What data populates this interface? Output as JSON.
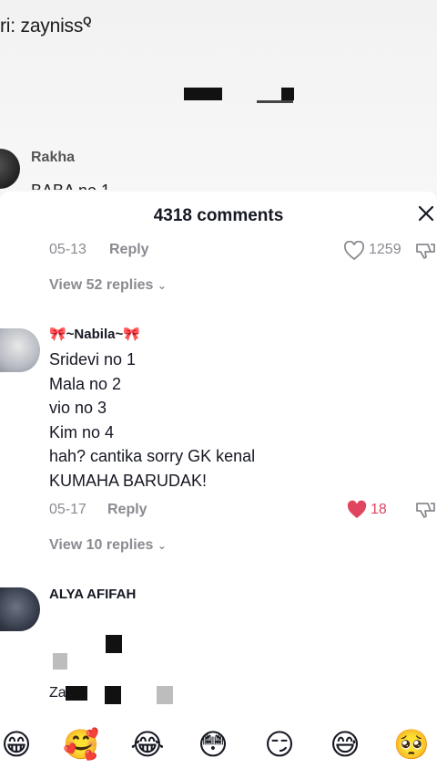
{
  "background": {
    "search_hint_prefix": "ri: zayniss",
    "search_hint_icon": "Q",
    "rakha_name": "Rakha",
    "rakha_text_partial": "BABA no 1"
  },
  "sheet": {
    "title": "4318 comments",
    "close_icon": "close-icon"
  },
  "comments": [
    {
      "date": "05-13",
      "reply_label": "Reply",
      "likes": "1259",
      "liked": false,
      "view_replies": "View 52 replies"
    },
    {
      "username": "🎀~Nabila~🎀",
      "lines": [
        "Sridevi no 1",
        "Mala no 2",
        "vio no 3",
        "Kim no 4",
        "hah? cantika sorry GK kenal",
        "KUMAHA BARUDAK!"
      ],
      "date": "05-17",
      "reply_label": "Reply",
      "likes": "18",
      "liked": true,
      "view_replies": "View 10 replies"
    },
    {
      "username": "ALYA AFIFAH",
      "partial_text": "Za"
    }
  ],
  "emoji_bar": [
    "😁",
    "🥰",
    "😂",
    "😳",
    "😏",
    "😅",
    "🥺"
  ],
  "colors": {
    "liked": "#e0455f",
    "muted": "#8a8b91",
    "text": "#161823"
  }
}
